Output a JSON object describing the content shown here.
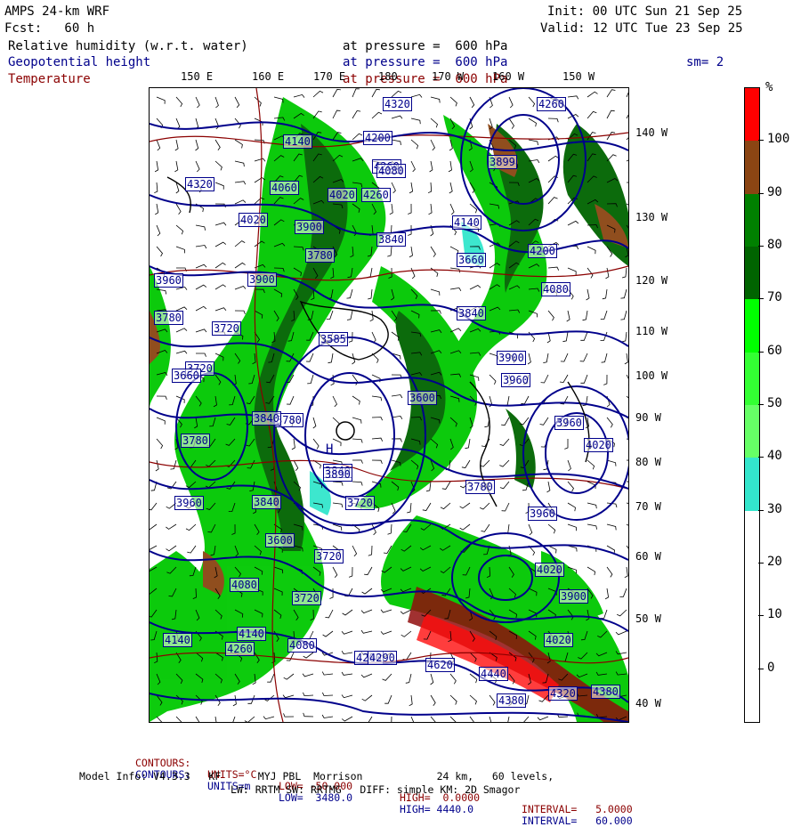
{
  "header": {
    "model_line": "AMPS 24-km WRF",
    "fcst_line": "Fcst:   60 h",
    "init_line": "Init: 00 UTC Sun 21 Sep 25",
    "valid_line": "Valid: 12 UTC Tue 23 Sep 25",
    "fields": [
      {
        "name": "Relative humidity (w.r.t. water)",
        "level": "at pressure =  600 hPa",
        "color": "#000000"
      },
      {
        "name": "Geopotential height",
        "level": "at pressure =  600 hPa",
        "color": "#00008b"
      },
      {
        "name": "Temperature",
        "level": "at pressure =  600 hPa",
        "color": "#8b0000"
      }
    ],
    "smoothing": "sm= 2"
  },
  "map": {
    "lon_labels_top": [
      "150 E",
      "160 E",
      "170 E",
      "180",
      "170 W",
      "160 W",
      "150 W"
    ],
    "lat_labels_right": [
      "140 W",
      "130 W",
      "120 W",
      "110 W",
      "100 W",
      "90 W",
      "80 W",
      "70 W",
      "60 W",
      "50 W",
      "40 W"
    ],
    "height_contour_labels": [
      "4320",
      "4260",
      "4140",
      "4200",
      "4260",
      "3899",
      "4320",
      "4060",
      "4020",
      "4080",
      "4260",
      "4020",
      "3900",
      "3840",
      "4140",
      "4200",
      "3780",
      "3660",
      "3960",
      "4080",
      "3900",
      "3720",
      "3585",
      "3780",
      "3840",
      "3960",
      "3720",
      "3660",
      "3780",
      "3780",
      "3840",
      "3600",
      "3900",
      "3840",
      "3890",
      "3960",
      "3780",
      "3720",
      "3960",
      "3840",
      "3600",
      "3720",
      "4080",
      "3720",
      "4140",
      "4080",
      "4140",
      "4260",
      "4200",
      "4290",
      "4620",
      "4440",
      "4380",
      "4320",
      "4380",
      "4020",
      "3900",
      "4020",
      "3960",
      "4020"
    ],
    "high_marker": "H",
    "colors": {
      "rh_30_40": "#33e6cc",
      "rh_50_60": "#00ff00",
      "rh_60_70": "#00c800",
      "rh_70_80": "#009600",
      "rh_80_90": "#006400",
      "rh_90_100": "#8b4513",
      "rh_100": "#ff0000",
      "height": "#00008b",
      "temp": "#8b0000"
    }
  },
  "colorbar": {
    "unit": "%",
    "labels": [
      "100",
      "90",
      "80",
      "70",
      "60",
      "50",
      "40",
      "30",
      "20",
      "10",
      "0"
    ],
    "segments": [
      "#ff0000",
      "#8b4513",
      "#008000",
      "#006400",
      "#00ff00",
      "#33ff33",
      "#66ff66",
      "#33e6cc",
      "#ffffff",
      "#ffffff",
      "#ffffff",
      "#ffffff"
    ]
  },
  "footer": {
    "temp_contours": {
      "label": "CONTOURS:",
      "units": "UNITS=°C",
      "low": "LOW= -50.000",
      "high": "HIGH=  0.0000",
      "interval": "INTERVAL=   5.0000"
    },
    "height_contours": {
      "label": "CONTOURS:",
      "units": "UNITS=m",
      "low": "LOW=  3480.0",
      "high": "HIGH= 4440.0",
      "interval": "INTERVAL=   60.000"
    },
    "model_info_line": "Model Info: V4.3.3   KF      MYJ PBL  Morrison            24 km,   60 levels,",
    "physics_line": "LW: RRTM SW: RRTMG   DIFF: simple KM: 2D Smagor"
  }
}
